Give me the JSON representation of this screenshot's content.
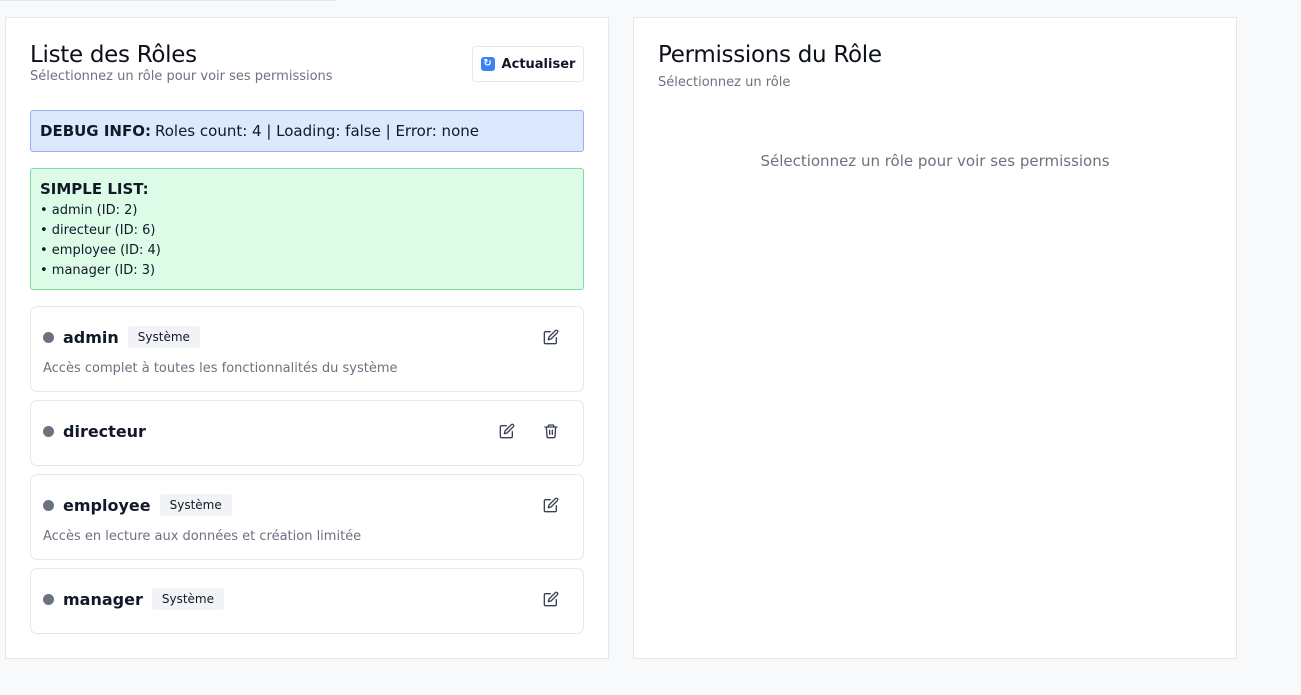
{
  "roles_panel": {
    "title": "Liste des Rôles",
    "subtitle": "Sélectionnez un rôle pour voir ses permissions",
    "refresh_label": "Actualiser",
    "debug": {
      "label": "DEBUG INFO:",
      "text": "Roles count: 4 | Loading: false | Error: none"
    },
    "simple_list": {
      "title": "SIMPLE LIST:",
      "items": [
        "• admin (ID: 2)",
        "• directeur (ID: 6)",
        "• employee (ID: 4)",
        "• manager (ID: 3)"
      ]
    },
    "roles": [
      {
        "name": "admin",
        "badge": "Système",
        "description": "Accès complet à toutes les fonctionnalités du système"
      },
      {
        "name": "directeur"
      },
      {
        "name": "employee",
        "badge": "Système",
        "description": "Accès en lecture aux données et création limitée"
      },
      {
        "name": "manager",
        "badge": "Système"
      }
    ]
  },
  "permissions_panel": {
    "title": "Permissions du Rôle",
    "subtitle": "Sélectionnez un rôle",
    "empty_message": "Sélectionnez un rôle pour voir ses permissions"
  },
  "icons": {
    "refresh": "refresh-icon",
    "edit": "edit-icon",
    "delete": "trash-icon",
    "status": "status-dot"
  },
  "colors": {
    "debug_bg": "#dbe8fd",
    "debug_border": "#93b4ee",
    "list_bg": "#dcfce7",
    "list_border": "#86d9a5",
    "status_dot": "#6b7280",
    "refresh_icon": "#3b82f6"
  }
}
